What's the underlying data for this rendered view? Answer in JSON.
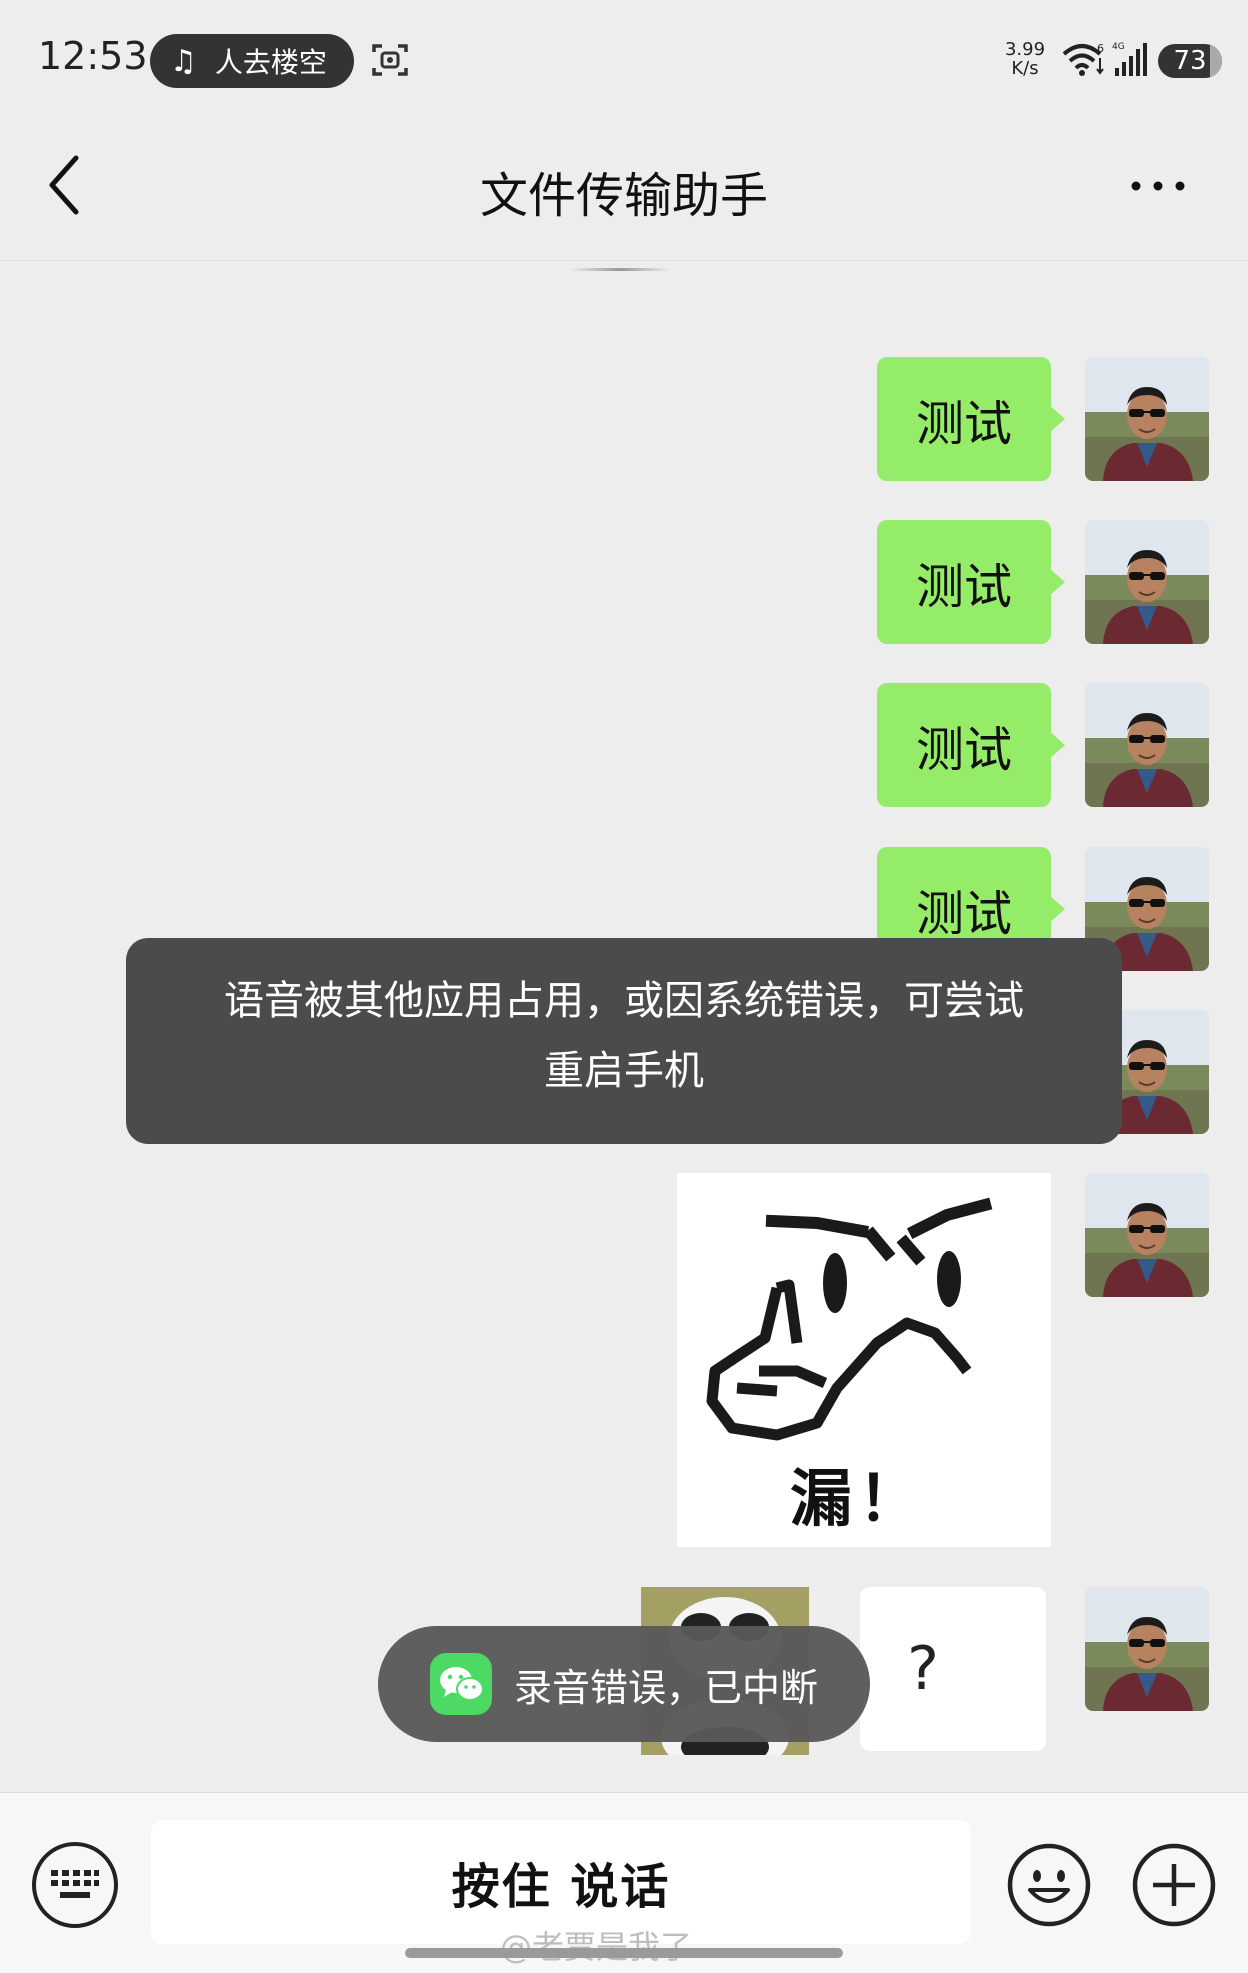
{
  "status_bar": {
    "time": "12:53",
    "music_title": "人去楼空",
    "net_speed_value": "3.99",
    "net_speed_unit": "K/s",
    "battery": "73"
  },
  "header": {
    "title": "文件传输助手"
  },
  "messages": [
    {
      "type": "text",
      "sender": "me",
      "text": "测试"
    },
    {
      "type": "text",
      "sender": "me",
      "text": "测试"
    },
    {
      "type": "text",
      "sender": "me",
      "text": "测试"
    },
    {
      "type": "text",
      "sender": "me",
      "text": "测试"
    },
    {
      "type": "text",
      "sender": "me",
      "text": ""
    },
    {
      "type": "sticker",
      "sender": "me",
      "caption": "漏！"
    },
    {
      "type": "text",
      "sender": "me",
      "text": "?"
    }
  ],
  "error_dialog": {
    "line1": "语音被其他应用占用，或因系统错误，可尝试",
    "line2": "重启手机"
  },
  "record_toast": {
    "text": "录音错误，已中断"
  },
  "input_bar": {
    "hold_to_talk_label": "按住 说话"
  },
  "watermark": "@老贾是我了",
  "colors": {
    "bubble_green": "#95ec69",
    "background": "#ededed",
    "toast_dark": "#4b4b4b"
  }
}
